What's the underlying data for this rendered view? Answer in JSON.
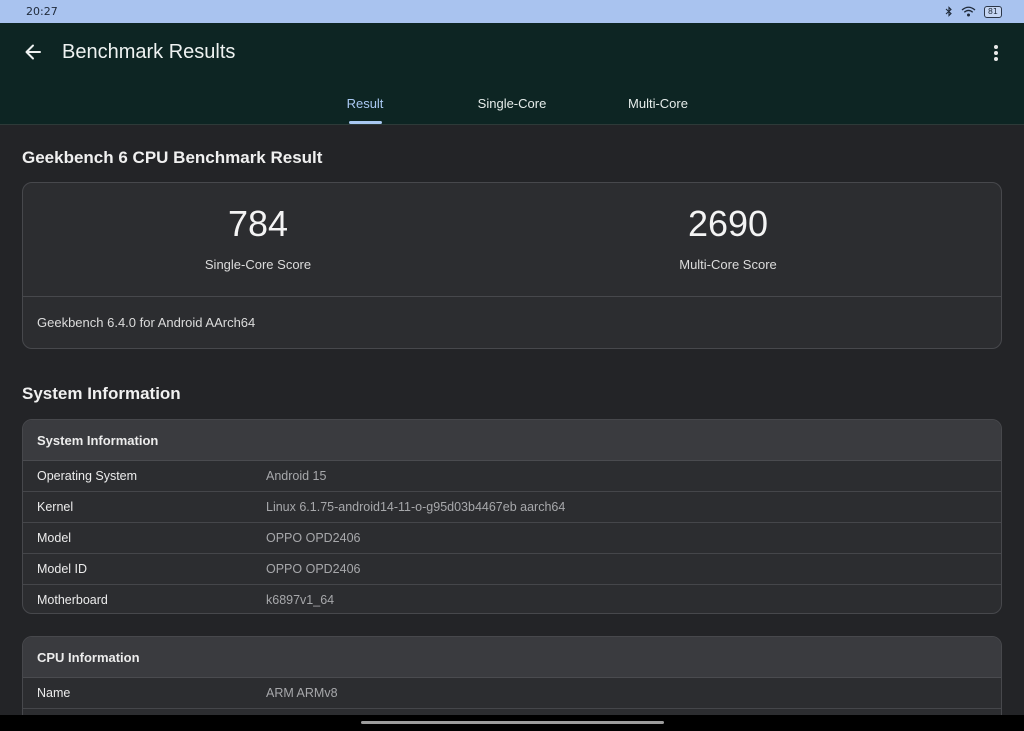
{
  "status_bar": {
    "time": "20:27",
    "battery": "81",
    "icons": [
      "bluetooth-icon",
      "wifi-icon",
      "battery-icon"
    ]
  },
  "app_bar": {
    "title": "Benchmark Results",
    "back_icon": "arrow-left-icon",
    "menu_icon": "more-vertical-icon"
  },
  "tabs": [
    {
      "label": "Result",
      "active": true
    },
    {
      "label": "Single-Core",
      "active": false
    },
    {
      "label": "Multi-Core",
      "active": false
    }
  ],
  "benchmark": {
    "heading": "Geekbench 6 CPU Benchmark Result",
    "single_core": {
      "score": "784",
      "label": "Single-Core Score"
    },
    "multi_core": {
      "score": "2690",
      "label": "Multi-Core Score"
    },
    "version": "Geekbench 6.4.0 for Android AArch64"
  },
  "system_information": {
    "heading": "System Information",
    "table_title": "System Information",
    "rows": [
      {
        "key": "Operating System",
        "value": "Android 15"
      },
      {
        "key": "Kernel",
        "value": "Linux 6.1.75-android14-11-o-g95d03b4467eb aarch64"
      },
      {
        "key": "Model",
        "value": "OPPO OPD2406"
      },
      {
        "key": "Model ID",
        "value": "OPPO OPD2406"
      },
      {
        "key": "Motherboard",
        "value": "k6897v1_64"
      }
    ]
  },
  "cpu_information": {
    "table_title": "CPU Information",
    "rows": [
      {
        "key": "Name",
        "value": "ARM ARMv8"
      }
    ]
  },
  "colors": {
    "app_bar": "#0d2523",
    "status_bar": "#a9c3ef",
    "accent": "#a9c8f2",
    "background": "#232427",
    "card": "#2c2d30"
  }
}
